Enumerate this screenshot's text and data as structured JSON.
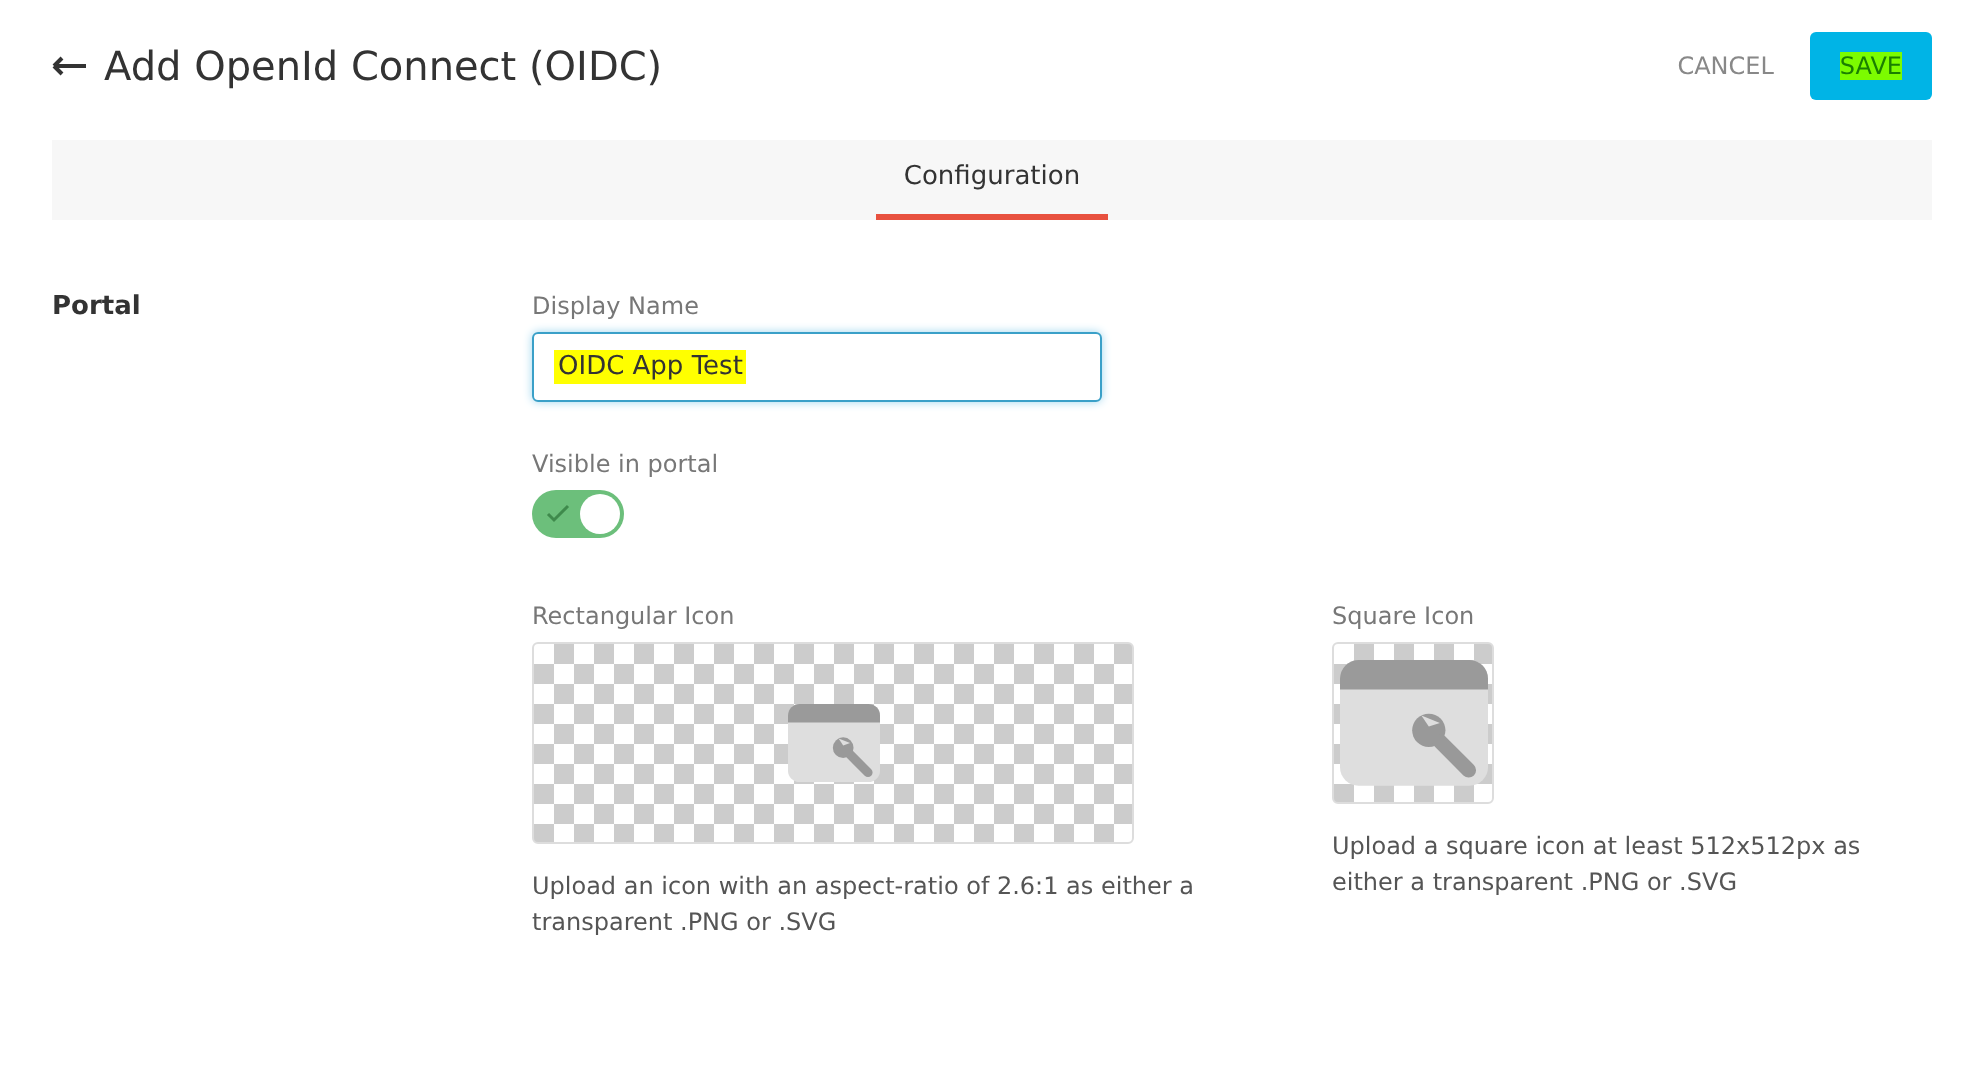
{
  "header": {
    "title": "Add OpenId Connect (OIDC)",
    "buttons": [
      {
        "label": "CANCEL",
        "kind": "text",
        "highlighted": false
      },
      {
        "label": "SAVE",
        "kind": "primary",
        "highlighted": true
      }
    ]
  },
  "tabs": [
    {
      "label": "Configuration",
      "selected": true
    }
  ],
  "section": {
    "label": "Portal",
    "display_name": {
      "label": "Display Name",
      "value": "OIDC App Test",
      "highlighted": true
    },
    "visible": {
      "label": "Visible in portal",
      "on": true
    },
    "icons": [
      {
        "label": "Rectangular Icon",
        "kind": "rectangular",
        "hint": "Upload an icon with an aspect-ratio of 2.6:1 as either a transparent .PNG or .SVG"
      },
      {
        "label": "Square Icon",
        "kind": "square",
        "hint": "Upload a square icon at least 512x512px as either a transparent .PNG or .SVG"
      }
    ]
  }
}
